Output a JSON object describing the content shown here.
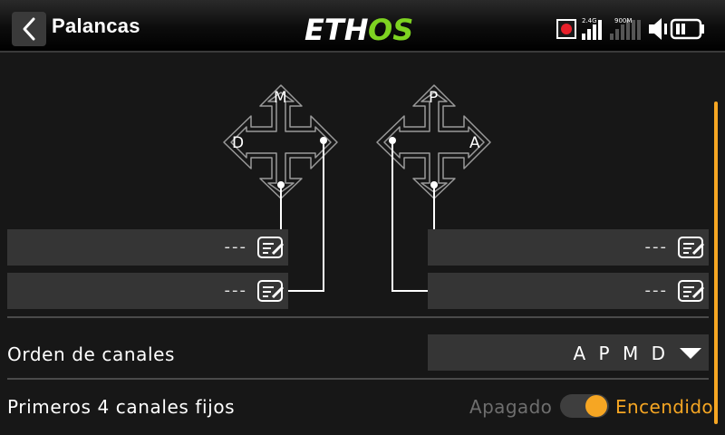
{
  "header": {
    "title": "Palancas",
    "logo": {
      "text_part1": "ETH",
      "text_part2": "OS",
      "color_part1": "#ffffff",
      "color_part2": "#7ed321"
    },
    "status": {
      "band1": "2.4G",
      "band2": "900M",
      "record_color": "#e8202a"
    }
  },
  "sticks": {
    "left": {
      "top": "M",
      "left": "D"
    },
    "right": {
      "top": "P",
      "right": "A"
    }
  },
  "fields": {
    "left_upper": "---",
    "left_lower": "---",
    "right_upper": "---",
    "right_lower": "---"
  },
  "channel_order": {
    "label": "Orden de canales",
    "value": "A P M D"
  },
  "fixed_channels": {
    "label": "Primeros 4 canales fijos",
    "off_label": "Apagado",
    "on_label": "Encendido",
    "enabled": true
  },
  "colors": {
    "accent": "#f6a623",
    "field_bg": "#353535",
    "background": "#171717"
  },
  "icons": [
    "back-icon",
    "record-icon",
    "signal-2g4-icon",
    "signal-900m-icon",
    "speaker-icon",
    "battery-icon",
    "edit-icon",
    "dropdown-arrow-icon"
  ]
}
